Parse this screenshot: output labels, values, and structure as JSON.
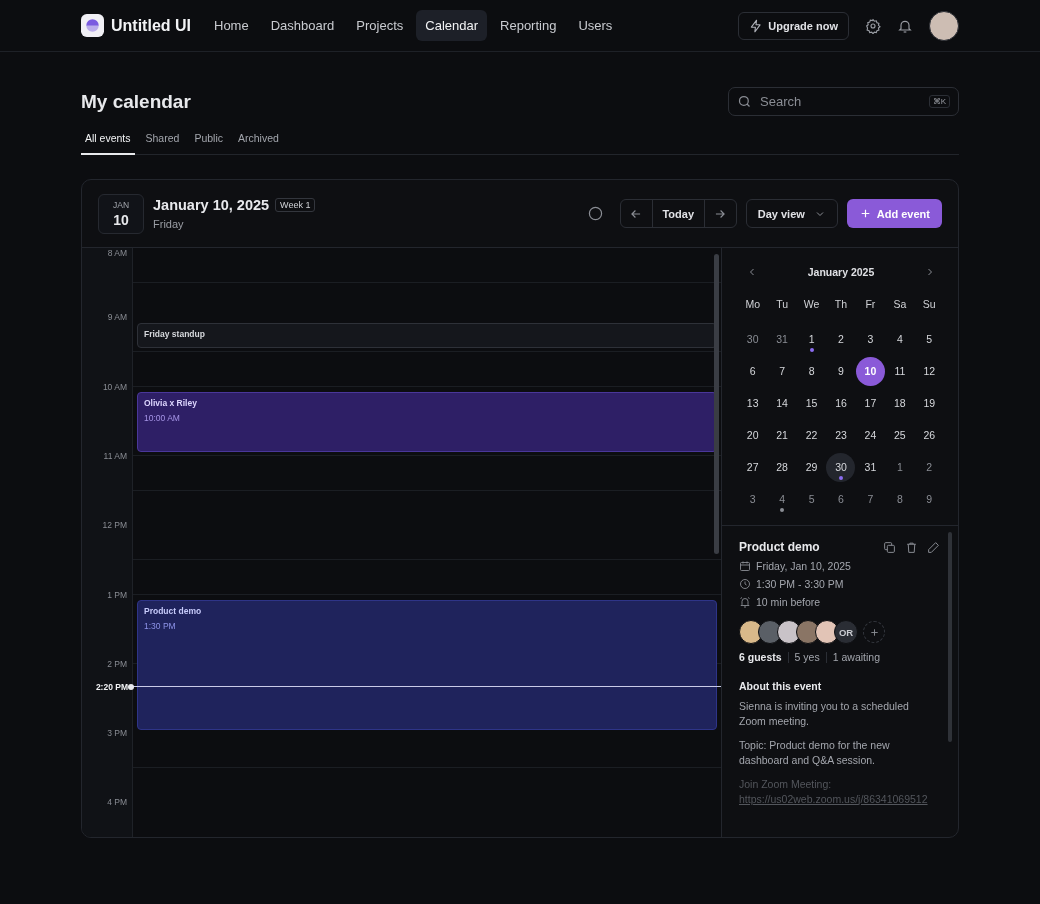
{
  "brand": {
    "name": "Untitled UI"
  },
  "nav": [
    {
      "label": "Home",
      "selected": false
    },
    {
      "label": "Dashboard",
      "selected": false
    },
    {
      "label": "Projects",
      "selected": false
    },
    {
      "label": "Calendar",
      "selected": true
    },
    {
      "label": "Reporting",
      "selected": false
    },
    {
      "label": "Users",
      "selected": false
    }
  ],
  "upgrade_button": "Upgrade now",
  "page_title": "My calendar",
  "search": {
    "placeholder": "Search",
    "shortcut": "⌘K"
  },
  "tabs": [
    {
      "label": "All events",
      "selected": true
    },
    {
      "label": "Shared",
      "selected": false
    },
    {
      "label": "Public",
      "selected": false
    },
    {
      "label": "Archived",
      "selected": false
    }
  ],
  "date_badge": {
    "month": "JAN",
    "day": "10"
  },
  "date_title": "January 10, 2025",
  "week_badge": "Week 1",
  "weekday": "Friday",
  "today_button": "Today",
  "view_select": "Day view",
  "add_button": "Add event",
  "hours": [
    "8 AM",
    "9 AM",
    "10 AM",
    "11 AM",
    "12 PM",
    "1 PM",
    "2 PM",
    "3 PM",
    "4 PM"
  ],
  "now_label": "2:20 PM",
  "events": [
    {
      "kind": "neutral",
      "title": "Friday standup"
    },
    {
      "kind": "purple",
      "title": "Olivia x Riley",
      "time": "10:00 AM"
    },
    {
      "kind": "indigo",
      "title": "Product demo",
      "time": "1:30 PM"
    }
  ],
  "mini_calendar": {
    "title": "January 2025",
    "weekdays": [
      "Mo",
      "Tu",
      "We",
      "Th",
      "Fr",
      "Sa",
      "Su"
    ],
    "weeks": [
      [
        {
          "label": "30",
          "outside": true,
          "selected": false,
          "today": false
        },
        {
          "label": "31",
          "outside": true,
          "selected": false,
          "today": false
        },
        {
          "label": "1",
          "outside": false,
          "selected": false,
          "today": false,
          "color": "#8b6cf0"
        },
        {
          "label": "2",
          "outside": false,
          "selected": false,
          "today": false
        },
        {
          "label": "3",
          "outside": false,
          "selected": false,
          "today": false
        },
        {
          "label": "4",
          "outside": false,
          "selected": false,
          "today": false
        },
        {
          "label": "5",
          "outside": false,
          "selected": false,
          "today": false
        }
      ],
      [
        {
          "label": "6",
          "outside": false,
          "selected": false,
          "today": false
        },
        {
          "label": "7",
          "outside": false,
          "selected": false,
          "today": false
        },
        {
          "label": "8",
          "outside": false,
          "selected": false,
          "today": false
        },
        {
          "label": "9",
          "outside": false,
          "selected": false,
          "today": false
        },
        {
          "label": "10",
          "outside": false,
          "selected": true,
          "today": false
        },
        {
          "label": "11",
          "outside": false,
          "selected": false,
          "today": false
        },
        {
          "label": "12",
          "outside": false,
          "selected": false,
          "today": false
        }
      ],
      [
        {
          "label": "13",
          "outside": false,
          "selected": false,
          "today": false
        },
        {
          "label": "14",
          "outside": false,
          "selected": false,
          "today": false
        },
        {
          "label": "15",
          "outside": false,
          "selected": false,
          "today": false
        },
        {
          "label": "16",
          "outside": false,
          "selected": false,
          "today": false
        },
        {
          "label": "17",
          "outside": false,
          "selected": false,
          "today": false
        },
        {
          "label": "18",
          "outside": false,
          "selected": false,
          "today": false
        },
        {
          "label": "19",
          "outside": false,
          "selected": false,
          "today": false
        }
      ],
      [
        {
          "label": "20",
          "outside": false,
          "selected": false,
          "today": false
        },
        {
          "label": "21",
          "outside": false,
          "selected": false,
          "today": false
        },
        {
          "label": "22",
          "outside": false,
          "selected": false,
          "today": false
        },
        {
          "label": "23",
          "outside": false,
          "selected": false,
          "today": false
        },
        {
          "label": "24",
          "outside": false,
          "selected": false,
          "today": false
        },
        {
          "label": "25",
          "outside": false,
          "selected": false,
          "today": false
        },
        {
          "label": "26",
          "outside": false,
          "selected": false,
          "today": false
        }
      ],
      [
        {
          "label": "27",
          "outside": false,
          "selected": false,
          "today": false
        },
        {
          "label": "28",
          "outside": false,
          "selected": false,
          "today": false
        },
        {
          "label": "29",
          "outside": false,
          "selected": false,
          "today": false
        },
        {
          "label": "30",
          "outside": false,
          "selected": false,
          "today": true,
          "color": "#8b6cf0"
        },
        {
          "label": "31",
          "outside": false,
          "selected": false,
          "today": false
        },
        {
          "label": "1",
          "outside": true,
          "selected": false,
          "today": false
        },
        {
          "label": "2",
          "outside": true,
          "selected": false,
          "today": false
        }
      ],
      [
        {
          "label": "3",
          "outside": true,
          "selected": false,
          "today": false
        },
        {
          "label": "4",
          "outside": true,
          "selected": false,
          "today": false,
          "color": "#8a8d94"
        },
        {
          "label": "5",
          "outside": true,
          "selected": false,
          "today": false
        },
        {
          "label": "6",
          "outside": true,
          "selected": false,
          "today": false
        },
        {
          "label": "7",
          "outside": true,
          "selected": false,
          "today": false
        },
        {
          "label": "8",
          "outside": true,
          "selected": false,
          "today": false
        },
        {
          "label": "9",
          "outside": true,
          "selected": false,
          "today": false
        }
      ]
    ]
  },
  "details": {
    "title": "Product demo",
    "date": "Friday, Jan 10, 2025",
    "time": "1:30 PM - 3:30 PM",
    "reminder": "10 min before",
    "guests": [
      {
        "kind": "photo",
        "color": "#d9b98a"
      },
      {
        "kind": "photo",
        "color": "#5a5f66"
      },
      {
        "kind": "photo",
        "color": "#c9c3c8"
      },
      {
        "kind": "photo",
        "color": "#8a7565"
      },
      {
        "kind": "photo",
        "color": "#e2c4b6"
      },
      {
        "kind": "initials",
        "initials": "OR"
      }
    ],
    "guest_count": "6 guests",
    "yes_count": "5 yes",
    "awaiting_count": "1 awaiting",
    "about_title": "About this event",
    "paragraphs": [
      "Sienna is inviting you to a scheduled Zoom meeting.",
      "Topic: Product demo for the new dashboard and Q&A session."
    ],
    "join_text": "Join Zoom Meeting:",
    "join_link": "https://us02web.zoom.us/j/86341069512"
  }
}
